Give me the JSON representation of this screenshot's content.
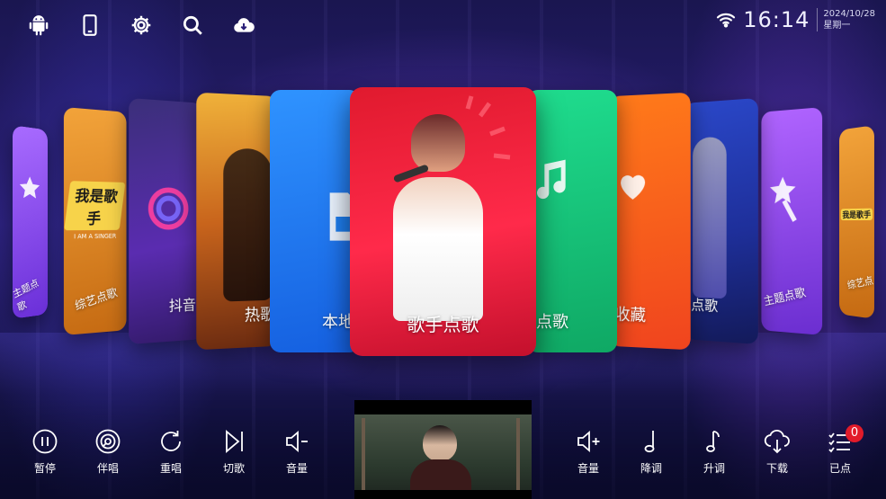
{
  "top_icons": [
    {
      "name": "android-icon"
    },
    {
      "name": "phone-icon"
    },
    {
      "name": "gear-icon"
    },
    {
      "name": "search-icon"
    },
    {
      "name": "cloud-download-icon"
    }
  ],
  "status": {
    "time": "16:14",
    "date": "2024/10/28",
    "weekday": "星期一"
  },
  "cards": {
    "far_left": {
      "label": "主题点歌"
    },
    "left3": {
      "label": "综艺点歌",
      "logo": "我是歌手",
      "logo_sub": "I AM A SINGER"
    },
    "left2": {
      "label": "抖音"
    },
    "left1": {
      "label": "热歌"
    },
    "left0": {
      "label": "本地"
    },
    "center": {
      "label": "歌手点歌"
    },
    "right0": {
      "label": "点歌"
    },
    "right1": {
      "label": "收藏"
    },
    "right2": {
      "label": "点歌"
    },
    "right3": {
      "label": "主题点歌"
    },
    "far_right": {
      "label": "综艺点",
      "logo": "我是歌手"
    }
  },
  "left_controls": [
    {
      "label": "暂停",
      "icon": "pause-icon"
    },
    {
      "label": "伴唱",
      "icon": "disc-icon"
    },
    {
      "label": "重唱",
      "icon": "replay-icon"
    },
    {
      "label": "切歌",
      "icon": "skip-icon"
    },
    {
      "label": "音量",
      "icon": "volume-down-icon"
    }
  ],
  "right_controls": [
    {
      "label": "音量",
      "icon": "volume-up-icon"
    },
    {
      "label": "降调",
      "icon": "note-down-icon"
    },
    {
      "label": "升调",
      "icon": "note-up-icon"
    },
    {
      "label": "下载",
      "icon": "download-icon"
    },
    {
      "label": "已点",
      "icon": "list-icon",
      "badge": "0"
    }
  ],
  "colors": {
    "accent_red": "#e21b2a",
    "card_center": "#e8163a",
    "card_blue": "#1e7ff0",
    "card_green": "#17c47a",
    "card_orange": "#ff5a1e",
    "card_purple": "#8a3cf0"
  }
}
